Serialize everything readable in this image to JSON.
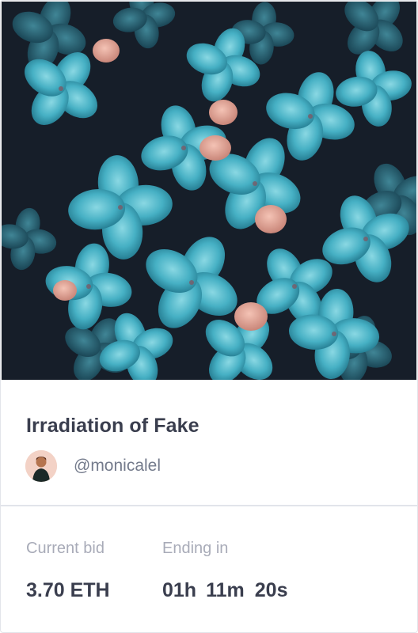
{
  "artwork": {
    "image_subject": "teal hydrangea flowers on dark background",
    "colors": {
      "background": "#161e29",
      "petal": "#3fa9bd",
      "petal_light": "#7fd2de",
      "pink": "#e9a99a"
    }
  },
  "item": {
    "title": "Irradiation of Fake",
    "creator_handle": "@monicalel",
    "avatar_icon": "creator-avatar"
  },
  "auction": {
    "current_bid_label": "Current bid",
    "current_bid_value": "3.70 ETH",
    "ending_label": "Ending in",
    "countdown": {
      "hours": "01h",
      "minutes": "11m",
      "seconds": "20s"
    }
  },
  "colors": {
    "title_text": "#3a3e4e",
    "muted_text": "#747b8c",
    "label_text": "#a8abb8",
    "border": "#e1e4ea"
  }
}
